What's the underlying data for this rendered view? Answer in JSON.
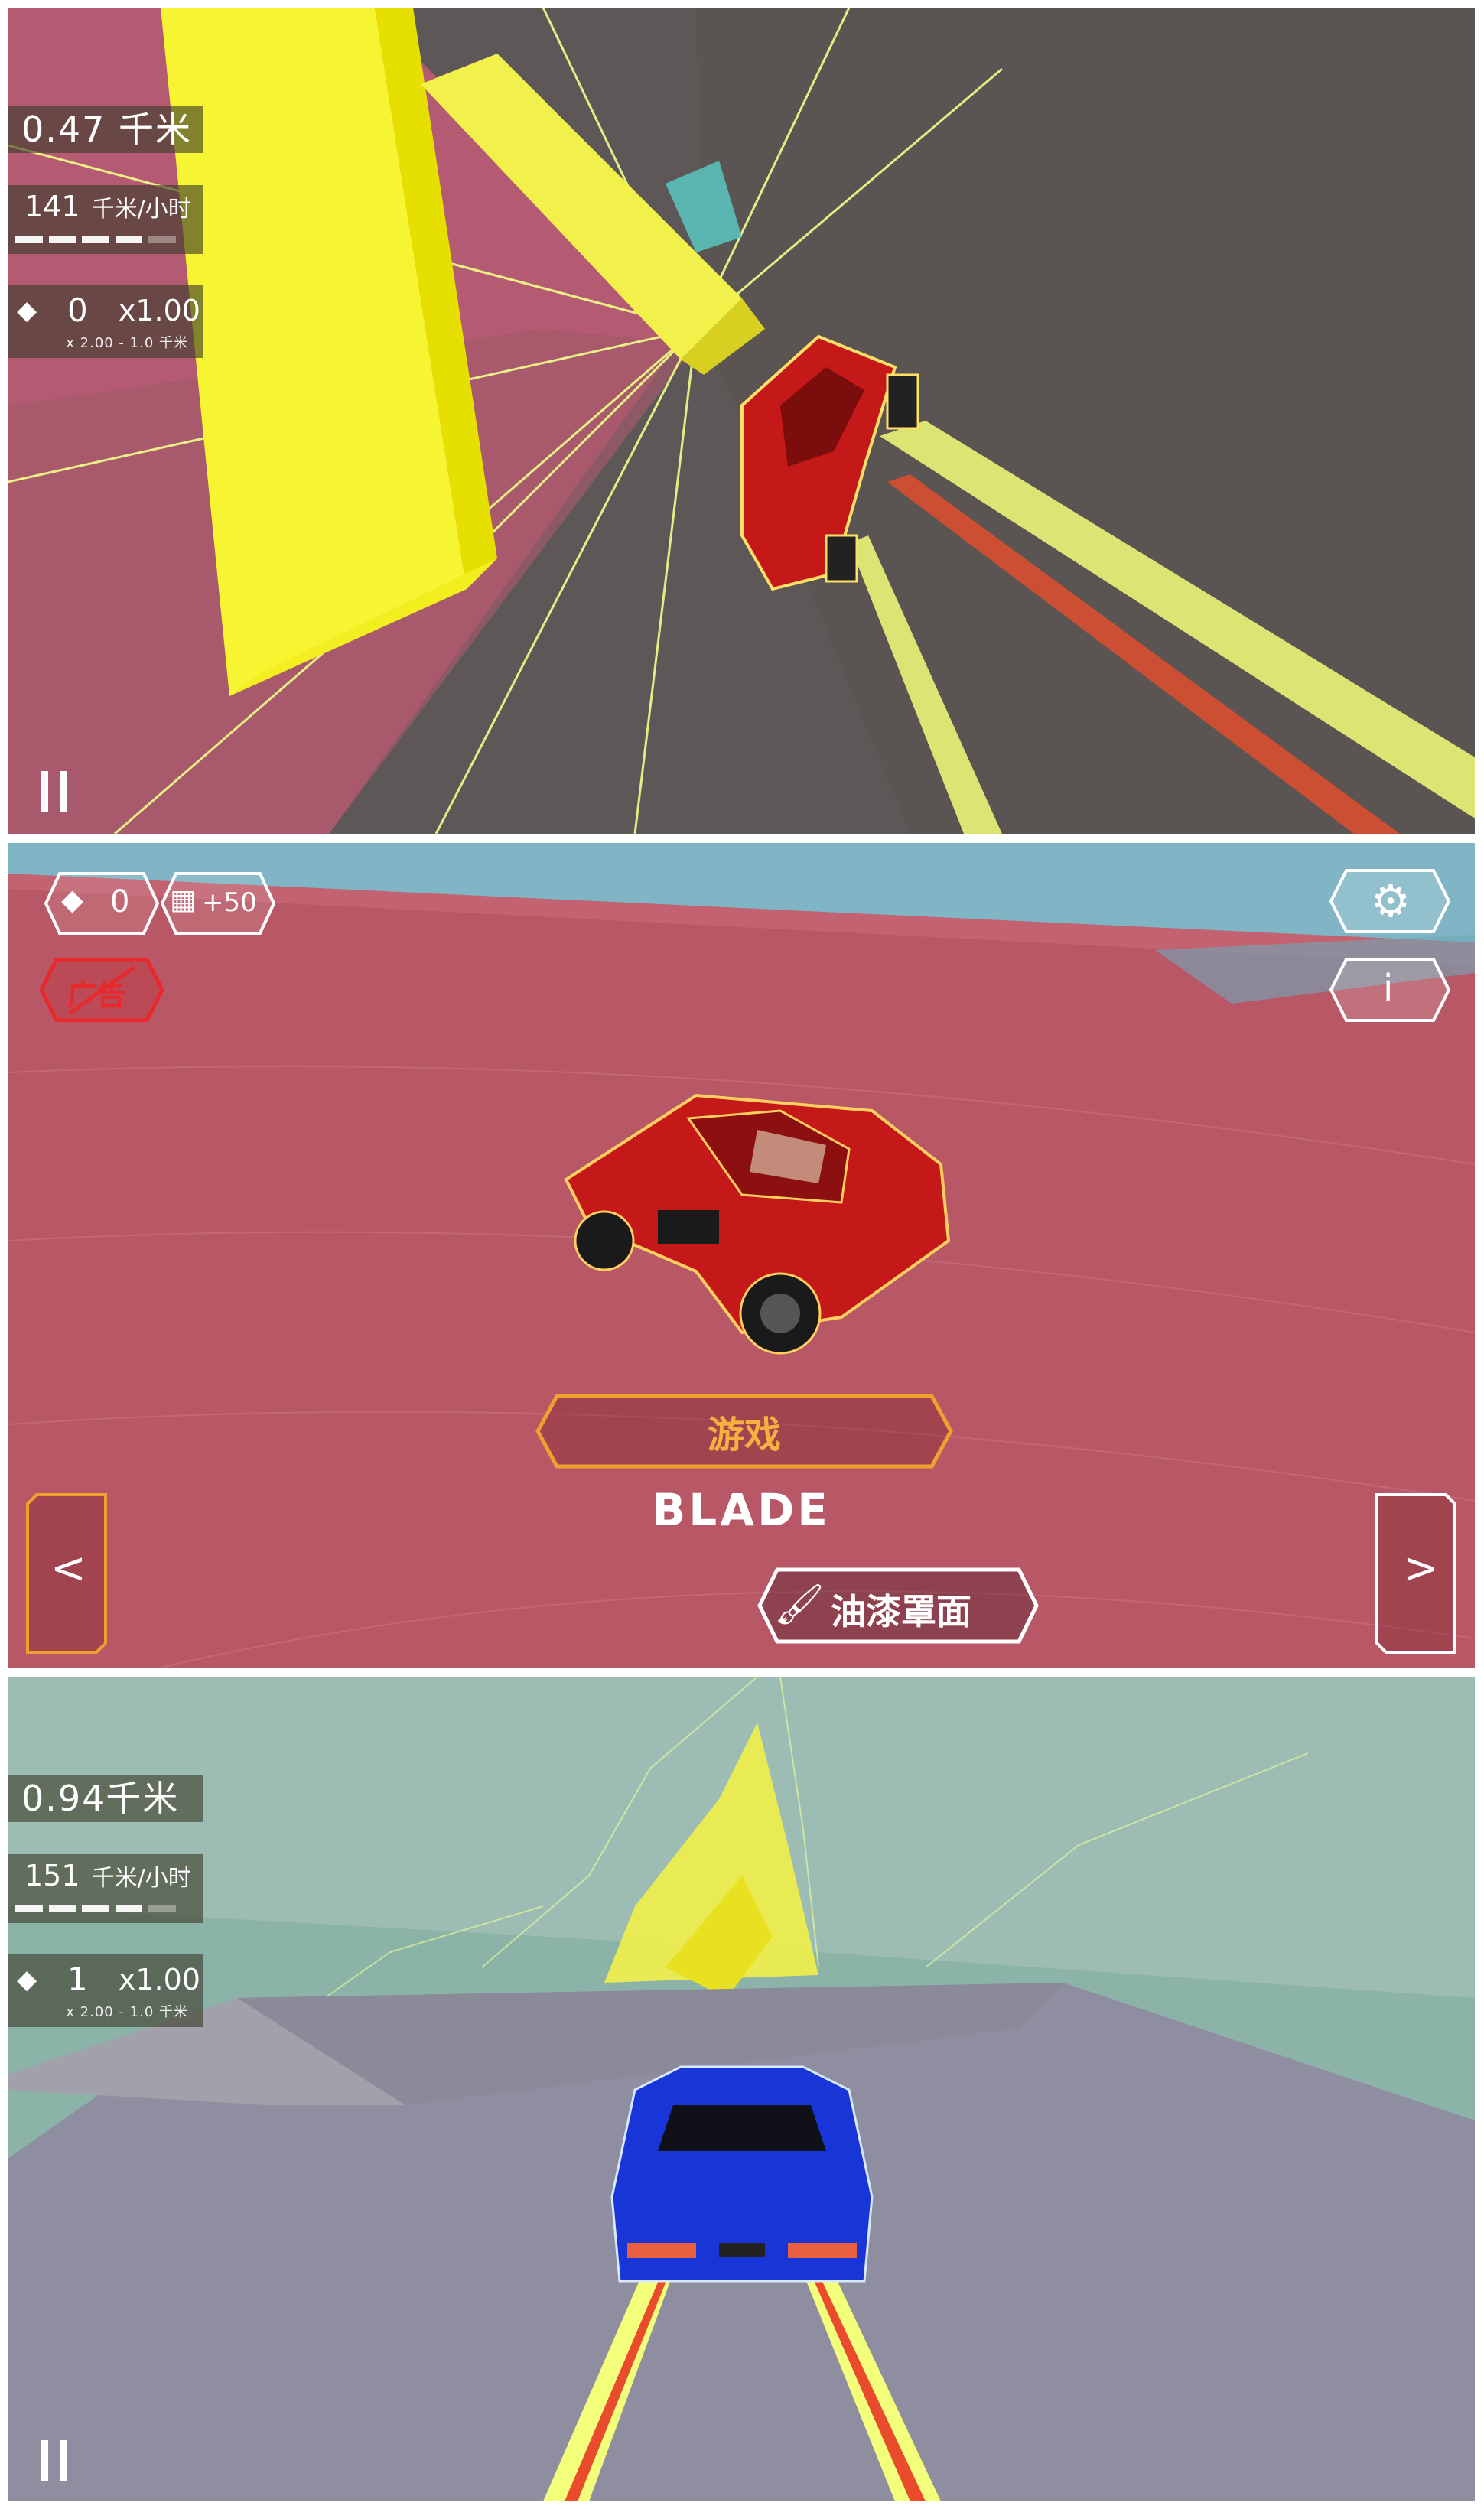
{
  "top_screen": {
    "distance": "0.47 千米",
    "speed_value": "141",
    "speed_unit": "千米/小时",
    "speed_level": 0.8,
    "gem_icon": "diamond-icon",
    "gems": "0",
    "multiplier": "x1.00",
    "multiplier_detail": "x 2.00 - 1.0 千米"
  },
  "menu_screen": {
    "gem_count": "0",
    "video_reward": "+50",
    "video_icon": "film-icon",
    "no_ads_label": "广告",
    "settings_icon": "gear-icon",
    "info_label": "i",
    "play_label": "游戏",
    "car_name": "BLADE",
    "paint_label": "油漆罩面",
    "paint_icon": "paint-roller-icon",
    "prev_label": "<",
    "next_label": ">"
  },
  "bottom_screen": {
    "distance": "0.94千米",
    "speed_value": "151",
    "speed_unit": "千米/小时",
    "speed_level": 0.8,
    "gem_icon": "diamond-icon",
    "gems": "1",
    "multiplier": "x1.00",
    "multiplier_detail": "x 2.00 - 1.0 千米"
  },
  "colors": {
    "tunnel_dark": "#5f5a58",
    "neon_yellow": "#f4ff3a",
    "pink_wall": "#b45a72",
    "menu_floor": "#b85866",
    "sky_blue": "#7fb5c4",
    "teal_wall": "#8bb3a8",
    "road_grey": "#8f8ea0",
    "orange_ui": "#f0a030",
    "red_car": "#c51818",
    "blue_car": "#1836d8"
  }
}
